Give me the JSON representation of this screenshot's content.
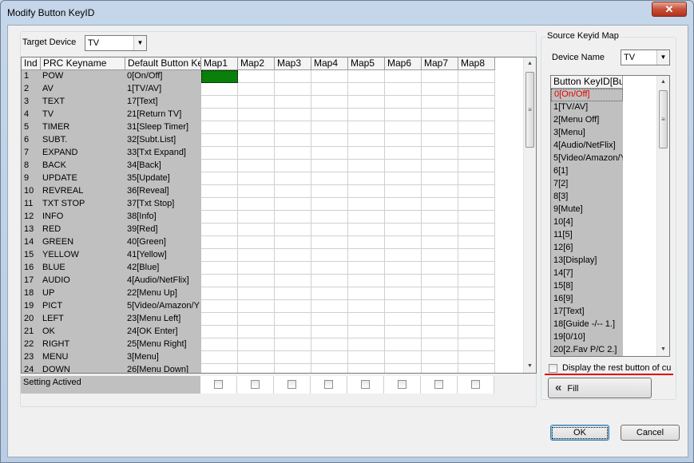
{
  "window": {
    "title": "Modify Button KeyID",
    "close_symbol": "✕"
  },
  "target_device": {
    "label": "Target Device",
    "value": "TV"
  },
  "grid": {
    "columns": [
      "Ind",
      "PRC Keyname",
      "Default Button Ke",
      "Map1",
      "Map2",
      "Map3",
      "Map4",
      "Map5",
      "Map6",
      "Map7",
      "Map8"
    ],
    "rows": [
      {
        "ind": "1",
        "key": "POW",
        "def": "0[On/Off]"
      },
      {
        "ind": "2",
        "key": "AV",
        "def": "1[TV/AV]"
      },
      {
        "ind": "3",
        "key": "TEXT",
        "def": "17[Text]"
      },
      {
        "ind": "4",
        "key": "TV",
        "def": "21[Return TV]"
      },
      {
        "ind": "5",
        "key": "TIMER",
        "def": "31[Sleep Timer]"
      },
      {
        "ind": "6",
        "key": "SUBT.",
        "def": "32[Subt.List]"
      },
      {
        "ind": "7",
        "key": "EXPAND",
        "def": "33[Txt Expand]"
      },
      {
        "ind": "8",
        "key": "BACK",
        "def": "34[Back]"
      },
      {
        "ind": "9",
        "key": "UPDATE",
        "def": "35[Update]"
      },
      {
        "ind": "10",
        "key": "REVREAL",
        "def": "36[Reveal]"
      },
      {
        "ind": "11",
        "key": "TXT STOP",
        "def": "37[Txt Stop]"
      },
      {
        "ind": "12",
        "key": "INFO",
        "def": "38[Info]"
      },
      {
        "ind": "13",
        "key": "RED",
        "def": "39[Red]"
      },
      {
        "ind": "14",
        "key": "GREEN",
        "def": "40[Green]"
      },
      {
        "ind": "15",
        "key": "YELLOW",
        "def": "41[Yellow]"
      },
      {
        "ind": "16",
        "key": "BLUE",
        "def": "42[Blue]"
      },
      {
        "ind": "17",
        "key": "AUDIO",
        "def": "4[Audio/NetFlix]"
      },
      {
        "ind": "18",
        "key": "UP",
        "def": "22[Menu Up]"
      },
      {
        "ind": "19",
        "key": "PICT",
        "def": "5[Video/Amazon/Y"
      },
      {
        "ind": "20",
        "key": "LEFT",
        "def": "23[Menu Left]"
      },
      {
        "ind": "21",
        "key": "OK",
        "def": "24[OK Enter]"
      },
      {
        "ind": "22",
        "key": "RIGHT",
        "def": "25[Menu Right]"
      },
      {
        "ind": "23",
        "key": "MENU",
        "def": "3[Menu]"
      },
      {
        "ind": "24",
        "key": "DOWN",
        "def": "26[Menu Down]"
      }
    ],
    "active_cell": {
      "row": 0,
      "map": 0,
      "color": "#0a7f0a"
    },
    "settings_label": "Setting Actived"
  },
  "source": {
    "group_label": "Source Keyid Map",
    "device_label": "Device Name",
    "device_value": "TV",
    "list_header": "Button KeyID[Bu",
    "items": [
      "0[On/Off]",
      "1[TV/AV]",
      "2[Menu Off]",
      "3[Menu]",
      "4[Audio/NetFlix]",
      "5[Video/Amazon/Y",
      "6[1]",
      "7[2]",
      "8[3]",
      "9[Mute]",
      "10[4]",
      "11[5]",
      "12[6]",
      "13[Display]",
      "14[7]",
      "15[8]",
      "16[9]",
      "17[Text]",
      "18[Guide -/-- 1.]",
      "19[0/10]",
      "20[2.Fav P/C 2.]"
    ],
    "selected_index": 0,
    "rest_check_label": "Display the rest button of cu",
    "fill_label": "Fill",
    "fill_icon": "«"
  },
  "buttons": {
    "ok": "OK",
    "cancel": "Cancel"
  },
  "colors": {
    "highlight_red": "#e00000",
    "grid_gray": "#c0c0c0"
  }
}
